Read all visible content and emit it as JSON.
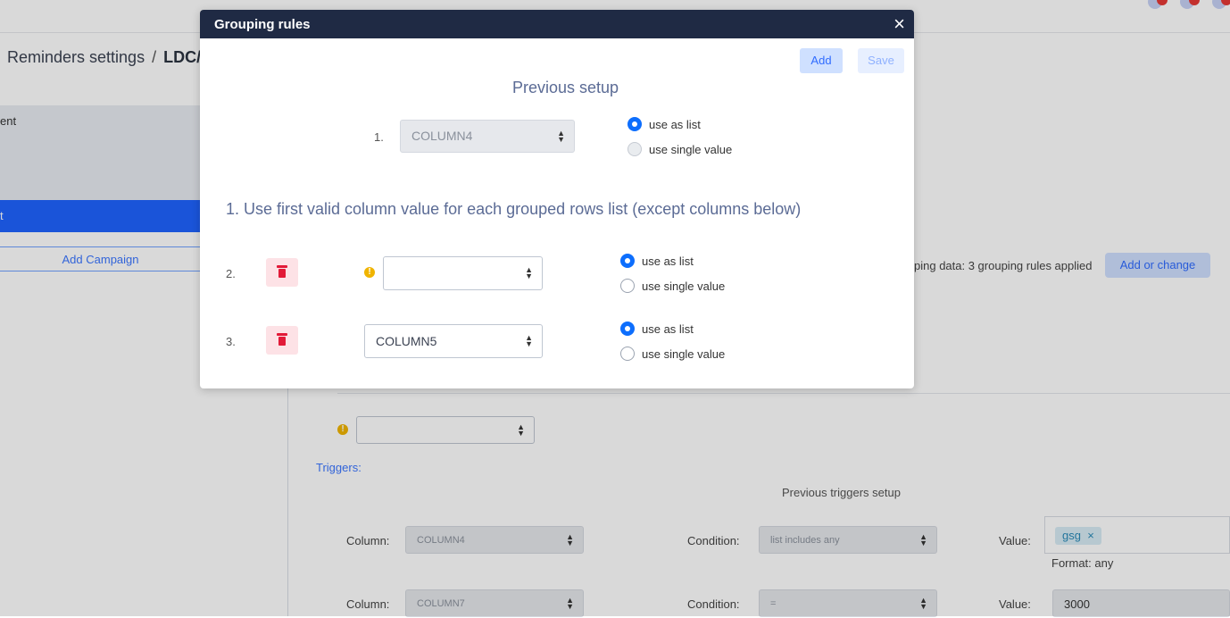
{
  "background": {
    "breadcrumb": {
      "part1": "Reminders settings",
      "separator": "/",
      "current": "LDC/"
    },
    "left_panel": {
      "text": "ent",
      "active_text": "t",
      "add_campaign": "Add Campaign"
    },
    "grouping": {
      "info_text": "ping data: 3 grouping rules applied",
      "button": "Add or change"
    },
    "triggers": {
      "title": "Triggers:",
      "previous_label": "Previous triggers setup",
      "rows": [
        {
          "column_label": "Column:",
          "column_value": "COLUMN4",
          "condition_label": "Condition:",
          "condition_value": "list includes any",
          "value_label": "Value:",
          "tag": "gsg",
          "tag_remove": "×",
          "format": "Format: any"
        },
        {
          "column_label": "Column:",
          "column_value": "COLUMN7",
          "condition_label": "Condition:",
          "condition_value": "=",
          "value_label": "Value:",
          "value": "3000"
        }
      ]
    }
  },
  "modal": {
    "title": "Grouping rules",
    "close": "×",
    "add_label": "Add",
    "save_label": "Save",
    "previous_setup": "Previous setup",
    "previous_row": {
      "number": "1.",
      "column": "COLUMN4",
      "option_list": "use as list",
      "option_single": "use single value",
      "selected": "use as list"
    },
    "section_title": "1. Use first valid column value for each grouped rows list (except columns below)",
    "rules": [
      {
        "number": "2.",
        "column": "",
        "option_list": "use as list",
        "option_single": "use single value",
        "selected": "use as list",
        "warning": "!"
      },
      {
        "number": "3.",
        "column": "COLUMN5",
        "option_list": "use as list",
        "option_single": "use single value",
        "selected": "use as list"
      }
    ]
  },
  "colors": {
    "header": "#1f2a44",
    "primary": "#0d6efd",
    "danger": "#e21a38",
    "accent": "#2f6bff"
  }
}
